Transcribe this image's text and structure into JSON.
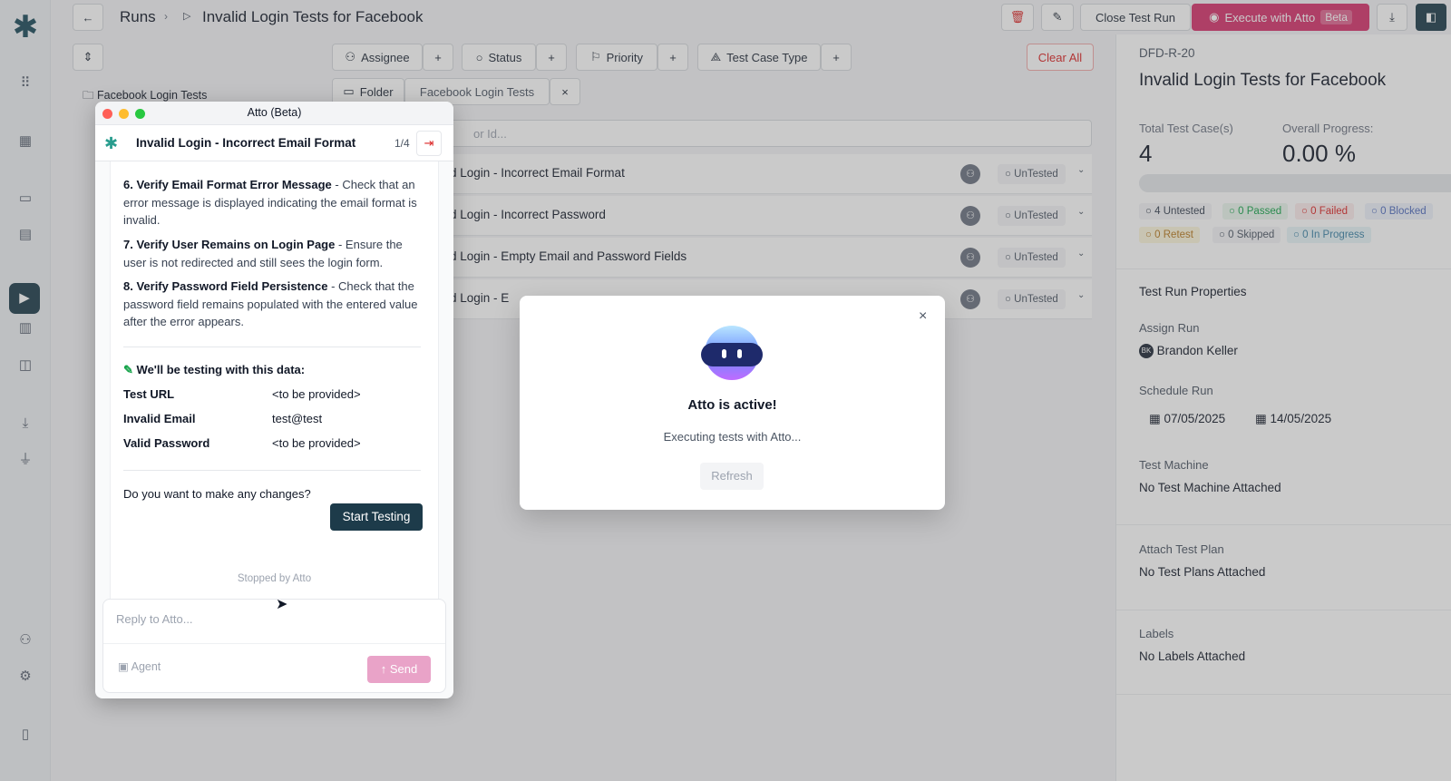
{
  "header": {
    "breadcrumb_root": "Runs",
    "title": "Invalid Login Tests for Facebook",
    "close_run_label": "Close Test Run",
    "execute_label": "Execute with Atto",
    "execute_badge": "Beta"
  },
  "filters": {
    "assignee": "Assignee",
    "status": "Status",
    "priority": "Priority",
    "test_case_type": "Test Case Type",
    "clear_all": "Clear All",
    "folder": "Folder",
    "folder_value": "Facebook Login Tests"
  },
  "sidebar": {
    "folder_item": "Facebook Login Tests"
  },
  "search": {
    "placeholder": "or Id..."
  },
  "test_rows": [
    {
      "title": "lid Login - Incorrect Email Format",
      "status": "UnTested"
    },
    {
      "title": "lid Login - Incorrect Password",
      "status": "UnTested"
    },
    {
      "title": "lid Login - Empty Email and Password Fields",
      "status": "UnTested"
    },
    {
      "title": "lid Login - E",
      "status": "UnTested"
    }
  ],
  "run_panel": {
    "id": "DFD-R-20",
    "title": "Invalid Login Tests for Facebook",
    "total_label": "Total Test Case(s)",
    "total_value": "4",
    "progress_label": "Overall Progress:",
    "progress_value": "0.00 %",
    "progress_fraction": 0,
    "pills": {
      "untested": "4 Untested",
      "passed": "0 Passed",
      "failed": "0 Failed",
      "blocked": "0 Blocked",
      "retest": "0 Retest",
      "skipped": "0 Skipped",
      "in_progress": "0 In Progress"
    },
    "properties_heading": "Test Run Properties",
    "assign_label": "Assign Run",
    "assignee_initials": "BK",
    "assignee_name": "Brandon Keller",
    "schedule_label": "Schedule Run",
    "start_date": "07/05/2025",
    "end_date": "14/05/2025",
    "machine_label": "Test Machine",
    "machine_value": "No Test Machine Attached",
    "plan_label": "Attach Test Plan",
    "plan_value": "No Test Plans Attached",
    "labels_label": "Labels",
    "labels_value": "No Labels Attached"
  },
  "chat": {
    "window_title": "Atto (Beta)",
    "case_title": "Invalid Login - Incorrect Email Format",
    "counter": "1/4",
    "steps": [
      {
        "title": "6. Verify Email Format Error Message",
        "text": " - Check that an error message is displayed indicating the email format is invalid."
      },
      {
        "title": "7. Verify User Remains on Login Page",
        "text": " - Ensure the user is not redirected and still sees the login form."
      },
      {
        "title": "8. Verify Password Field Persistence",
        "text": " - Check that the password field remains populated with the entered value after the error appears."
      }
    ],
    "data_heading": "We'll be testing with this data:",
    "data_rows": [
      {
        "key": "Test URL",
        "value": "<to be provided>"
      },
      {
        "key": "Invalid Email",
        "value": "test@test"
      },
      {
        "key": "Valid Password",
        "value": "<to be provided>"
      }
    ],
    "question": "Do you want to make any changes?",
    "start_button": "Start Testing",
    "stopped_note": "Stopped by Atto",
    "reply_placeholder": "Reply to Atto...",
    "agent_label": "Agent",
    "send_label": "Send"
  },
  "modal": {
    "title": "Atto is active!",
    "subtitle": "Executing tests with Atto...",
    "refresh_label": "Refresh"
  },
  "colors": {
    "accent": "#1d3b4a",
    "execute": "#d6336c",
    "danger": "#dc2626",
    "send": "#e9a3c8"
  }
}
